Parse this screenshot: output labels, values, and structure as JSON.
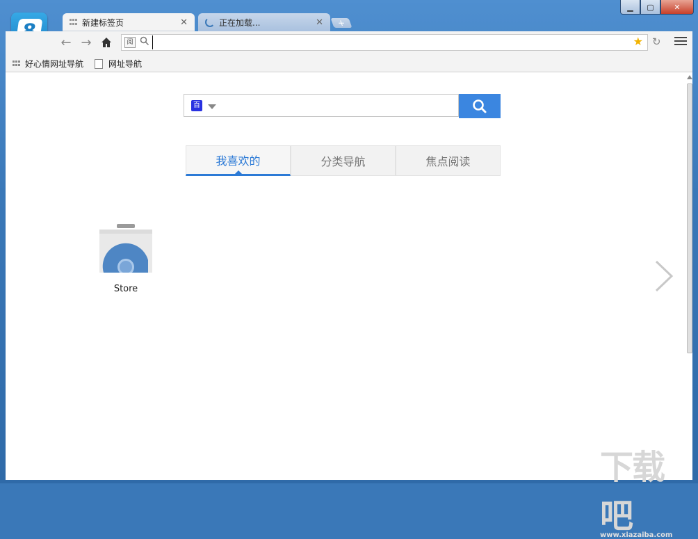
{
  "window": {
    "minimize": "▁",
    "maximize": "▢",
    "close": "✕"
  },
  "tabs": [
    {
      "label": "新建标签页",
      "close": "✕"
    },
    {
      "label": "正在加载...",
      "close": "✕"
    }
  ],
  "new_tab": "+",
  "omnibox": {
    "badge": "阅",
    "value": "",
    "placeholder": ""
  },
  "bookmarks": [
    {
      "label": "好心情网址导航"
    },
    {
      "label": "网址导航"
    }
  ],
  "search": {
    "engine": "百",
    "value": "",
    "placeholder": ""
  },
  "content_tabs": [
    "我喜欢的",
    "分类导航",
    "焦点阅读"
  ],
  "apps": [
    {
      "label": "Store"
    }
  ],
  "watermark": {
    "main": "下载吧",
    "sub": "www.xiazaiba.com"
  },
  "colors": {
    "accent": "#3b86e0",
    "titlebar": "#3a78b8",
    "star": "#f2b300"
  }
}
